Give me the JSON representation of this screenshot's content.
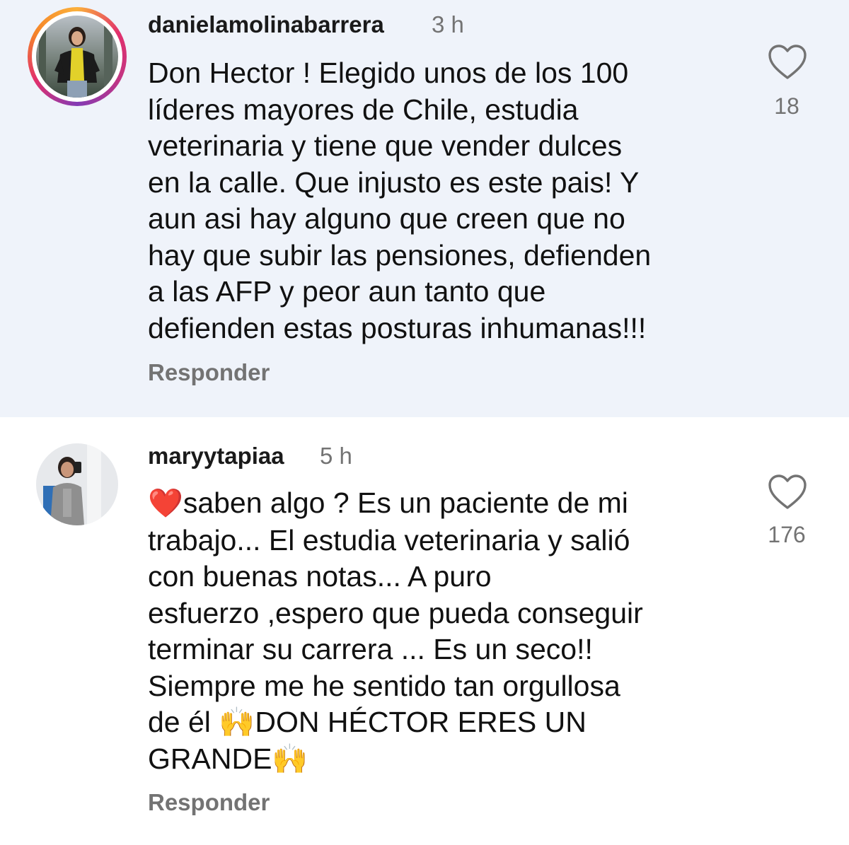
{
  "comments": [
    {
      "username": "danielamolinabarrera",
      "time": "3 h",
      "text_lines": [
        "Don Hector ! Elegido unos de los 100",
        "líderes mayores de Chile, estudia",
        "veterinaria y tiene que vender dulces",
        "en la calle. Que injusto es este pais! Y",
        "aun asi hay alguno que creen que no",
        "hay que subir las pensiones, defienden",
        "a las AFP y peor aun tanto que",
        "defienden estas posturas inhumanas!!!"
      ],
      "reply_label": "Responder",
      "likes": "18",
      "has_story_ring": true
    },
    {
      "username": "maryytapiaa",
      "time": "5 h",
      "lead_emoji": "❤️",
      "text_lines": [
        "saben algo ? Es un paciente de mi",
        "trabajo... El estudia veterinaria y salió",
        "con buenas notas... A puro",
        "esfuerzo ,espero que pueda conseguir",
        "terminar su carrera ... Es un seco!!",
        "Siempre me he sentido tan orgullosa",
        "de él ",
        "DON HÉCTOR ERES UN",
        "GRANDE"
      ],
      "emoji_raised_hands": "🙌",
      "reply_label": "Responder",
      "likes": "176",
      "has_story_ring": false
    }
  ],
  "colors": {
    "highlight_bg": "#eff3fa",
    "secondary_text": "#737373",
    "primary_text": "#111111",
    "heart_red": "#e0242c"
  },
  "icons": {
    "like": "heart-outline-icon",
    "lead": "red-heart-emoji",
    "celebrate": "raised-hands-emoji"
  }
}
